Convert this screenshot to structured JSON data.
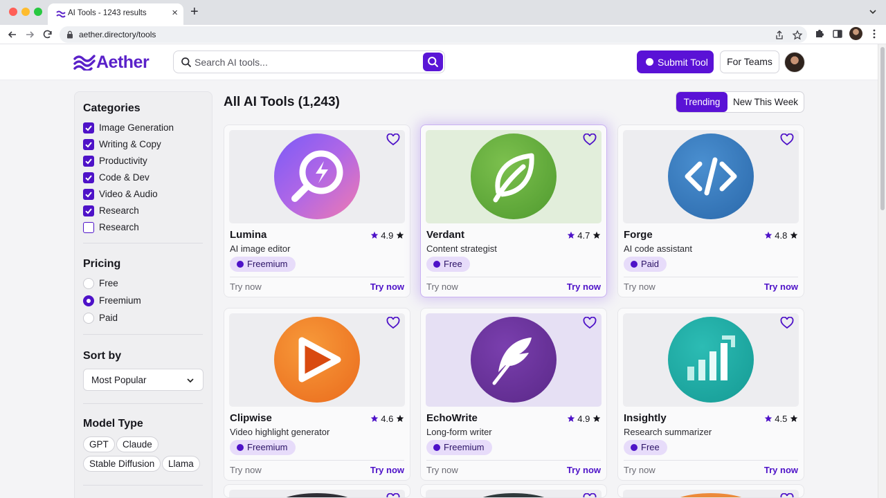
{
  "browser": {
    "tab_title": "AI Tools - 1243 results",
    "url": "aether.directory/tools"
  },
  "header": {
    "logo_text": "Aether",
    "search_placeholder": "Search AI tools...",
    "submit_label": "Submit Tool",
    "teams_label": "For Teams"
  },
  "sidebar": {
    "categories_title": "Categories",
    "categories": [
      {
        "label": "Image Generation",
        "checked": true
      },
      {
        "label": "Writing & Copy",
        "checked": true
      },
      {
        "label": "Productivity",
        "checked": true
      },
      {
        "label": "Code & Dev",
        "checked": true
      },
      {
        "label": "Video & Audio",
        "checked": true
      },
      {
        "label": "Research",
        "checked": true
      },
      {
        "label": "Research",
        "checked": false
      }
    ],
    "pricing_title": "Pricing",
    "pricing": [
      {
        "label": "Free",
        "selected": false
      },
      {
        "label": "Freemium",
        "selected": true
      },
      {
        "label": "Paid",
        "selected": false
      }
    ],
    "sort_title": "Sort by",
    "sort_value": "Most Popular",
    "model_title": "Model Type",
    "models": [
      "GPT",
      "Claude",
      "Stable Diffusion",
      "Llama"
    ]
  },
  "main": {
    "title": "All AI Tools (1,243)",
    "toggle_active": "Trending",
    "toggle_inactive": "New This Week"
  },
  "cards": [
    {
      "name": "Lumina",
      "rating": "4.9",
      "subtitle": "AI image editor",
      "badge": "Freemium",
      "try_left": "Try now",
      "try_right": "Try now",
      "icon": "sparkle-search-icon"
    },
    {
      "name": "Verdant",
      "rating": "4.7",
      "subtitle": "Content strategist",
      "badge": "Free",
      "try_left": "Try now",
      "try_right": "Try now",
      "icon": "leaf-icon"
    },
    {
      "name": "Forge",
      "rating": "4.8",
      "subtitle": "AI code assistant",
      "badge": "Paid",
      "try_left": "Try now",
      "try_right": "Try now",
      "icon": "code-brackets-icon"
    },
    {
      "name": "Clipwise",
      "rating": "4.6",
      "subtitle": "Video highlight generator",
      "badge": "Freemium",
      "try_left": "Try now",
      "try_right": "Try now",
      "icon": "play-icon"
    },
    {
      "name": "EchoWrite",
      "rating": "4.9",
      "subtitle": "Long-form writer",
      "badge": "Freemium",
      "try_left": "Try now",
      "try_right": "Try now",
      "icon": "feather-icon"
    },
    {
      "name": "Insightly",
      "rating": "4.5",
      "subtitle": "Research summarizer",
      "badge": "Free",
      "try_left": "Try now",
      "try_right": "Try now",
      "icon": "bar-chart-icon"
    }
  ],
  "colors": {
    "accent": "#5a12d6",
    "badge_bg": "#e7dcfa",
    "page_bg": "#f4f4f6"
  }
}
